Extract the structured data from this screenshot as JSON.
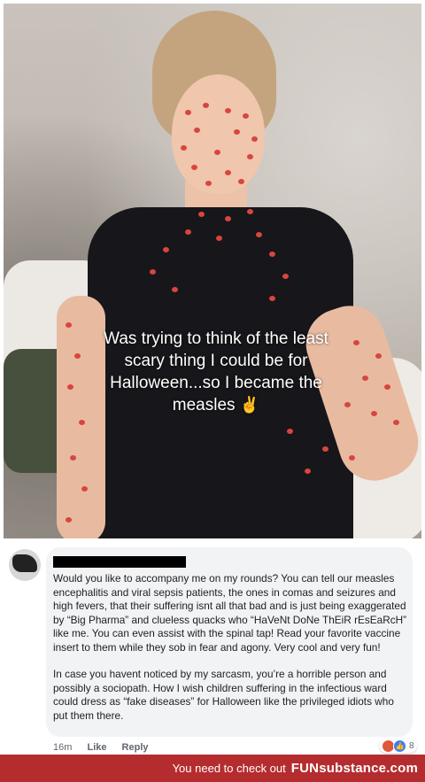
{
  "photo": {
    "caption_lines": [
      "Was trying to think of the least",
      "scary thing I could be for",
      "Halloween...so I became the",
      "measles"
    ],
    "caption_emoji": "✌"
  },
  "comment": {
    "author_redacted": "",
    "paragraphs": [
      "Would you like to accompany me on my rounds? You can tell our measles encephalitis and viral sepsis patients, the ones in comas and seizures and high fevers, that their suffering isnt all that bad and is just being exaggerated by “Big Pharma” and clueless quacks who “HaVeNt DoNe ThEiR rEsEaRcH” like me. You can even assist with the spinal tap! Read your favorite vaccine insert to them while they sob in fear and agony. Very cool and very fun!",
      "In case you havent noticed by my sarcasm, you’re a horrible person and possibly a sociopath. How I wish children suffering in the infectious ward could dress as “fake diseases” for Halloween like the privileged idiots who put them there."
    ],
    "timestamp": "16m",
    "like_label": "Like",
    "reply_label": "Reply",
    "reaction_count": "8"
  },
  "footer": {
    "text": "You need to check out",
    "brand": "FUNsubstance.com"
  },
  "colors": {
    "footer_bg": "#b52c2f",
    "bubble_bg": "#f2f3f5",
    "measles_dot": "#d8453f"
  }
}
